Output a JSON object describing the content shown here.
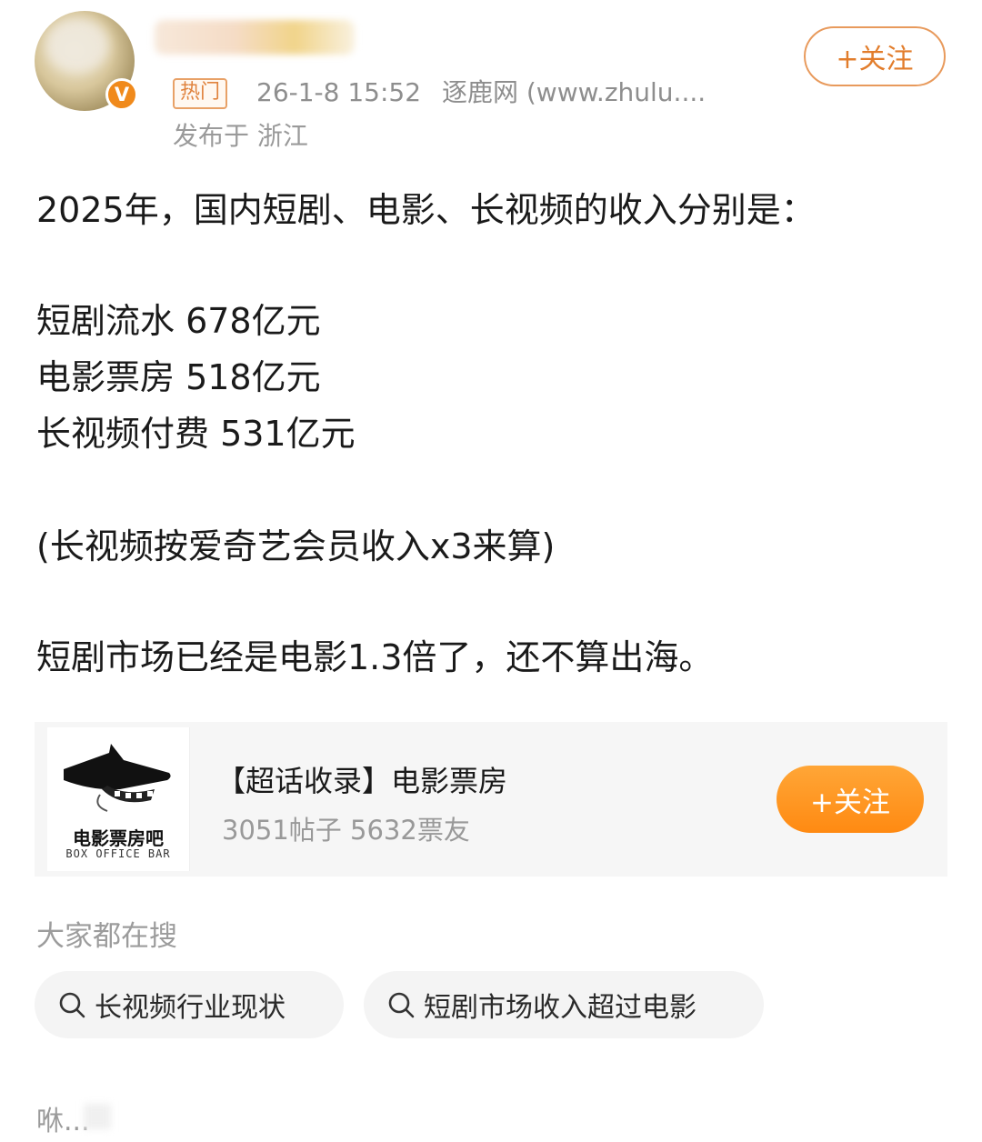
{
  "header": {
    "hot_tag": "热门",
    "timestamp": "26-1-8 15:52",
    "source": "逐鹿网 (www.zhulu....",
    "location": "发布于 浙江",
    "follow_label": "+关注"
  },
  "post": {
    "lines": [
      "2025年，国内短剧、电影、长视频的收入分别是：",
      "短剧流水 678亿元",
      "电影票房 518亿元",
      "长视频付费 531亿元",
      "(长视频按爱奇艺会员收入x3来算)",
      "短剧市场已经是电影1.3倍了，还不算出海。"
    ]
  },
  "topic_card": {
    "logo_title": "电影票房吧",
    "logo_subtitle": "BOX OFFICE BAR",
    "title": "【超话收录】电影票房",
    "stats": "3051帖子 5632票友",
    "follow_label": "+关注"
  },
  "search": {
    "heading": "大家都在搜",
    "chips": [
      "长视频行业现状",
      "短剧市场收入超过电影"
    ]
  },
  "footer": {
    "text": "咻..."
  },
  "colors": {
    "accent_orange": "#ff8a12",
    "tag_orange": "#e0833e",
    "muted_text": "#9a9a9a"
  }
}
